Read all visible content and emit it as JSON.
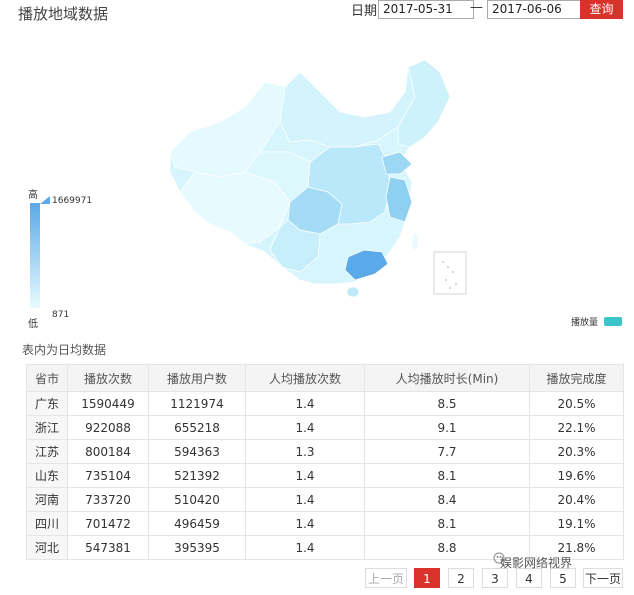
{
  "header": {
    "title": "播放地域数据",
    "date_label": "日期",
    "start_date": "2017-05-31",
    "date_separator": "—",
    "end_date": "2017-06-06",
    "query_label": "查询"
  },
  "map": {
    "visual_map": {
      "high_label": "高",
      "low_label": "低",
      "max_value": "1669971",
      "min_value": "871",
      "color_high": "#5aa9e8",
      "color_low": "#e7fbff"
    },
    "series_legend": "播放量",
    "series_color": "#3cc5c9"
  },
  "note": "表内为日均数据",
  "table": {
    "headers": [
      "省市",
      "播放次数",
      "播放用户数",
      "人均播放次数",
      "人均播放时长(Min)",
      "播放完成度"
    ],
    "rows": [
      [
        "广东",
        "1590449",
        "1121974",
        "1.4",
        "8.5",
        "20.5%"
      ],
      [
        "浙江",
        "922088",
        "655218",
        "1.4",
        "9.1",
        "22.1%"
      ],
      [
        "江苏",
        "800184",
        "594363",
        "1.3",
        "7.7",
        "20.3%"
      ],
      [
        "山东",
        "735104",
        "521392",
        "1.4",
        "8.1",
        "19.6%"
      ],
      [
        "河南",
        "733720",
        "510420",
        "1.4",
        "8.4",
        "20.4%"
      ],
      [
        "四川",
        "701472",
        "496459",
        "1.4",
        "8.1",
        "19.1%"
      ],
      [
        "河北",
        "547381",
        "395395",
        "1.4",
        "8.8",
        "21.8%"
      ]
    ]
  },
  "pagination": {
    "prev_label": "上一页",
    "pages": [
      "1",
      "2",
      "3",
      "4",
      "5"
    ],
    "active_page": "1",
    "next_label": "下一页"
  },
  "watermark": "娱影网络视界",
  "colors": {
    "accent": "#d9322a"
  }
}
